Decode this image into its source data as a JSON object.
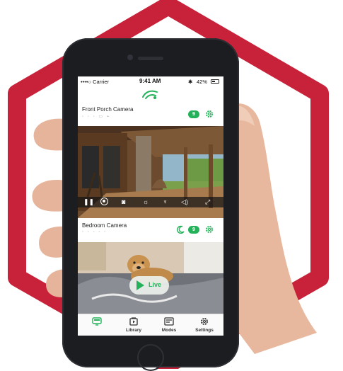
{
  "colors": {
    "frame": "#c8223a",
    "accent": "#23b25a",
    "phone": "#1c1d20"
  },
  "status_bar": {
    "carrier": "••••○ Carrier",
    "time": "9:41 AM",
    "bluetooth": "✱",
    "battery": "42%"
  },
  "app_logo": "app-logo-icon",
  "cameras": [
    {
      "name": "Front Porch Camera",
      "badge": "9",
      "status_icons": "◦ ◦ ◦ ▭ ⌁",
      "controls": [
        "pause-icon",
        "record-icon",
        "snapshot-icon",
        "brightness-icon",
        "microphone-icon",
        "volume-icon",
        "fullscreen-icon"
      ]
    },
    {
      "name": "Bedroom Camera",
      "badge": "9",
      "status_icons": "◦ ◦ ◦ ◦ ◦",
      "live_label": "Live"
    }
  ],
  "tabs": [
    {
      "label": "",
      "icon": "cameras-icon",
      "active": true
    },
    {
      "label": "Library",
      "icon": "library-icon",
      "active": false
    },
    {
      "label": "Modes",
      "icon": "modes-icon",
      "active": false
    },
    {
      "label": "Settings",
      "icon": "gear-icon",
      "active": false
    }
  ]
}
